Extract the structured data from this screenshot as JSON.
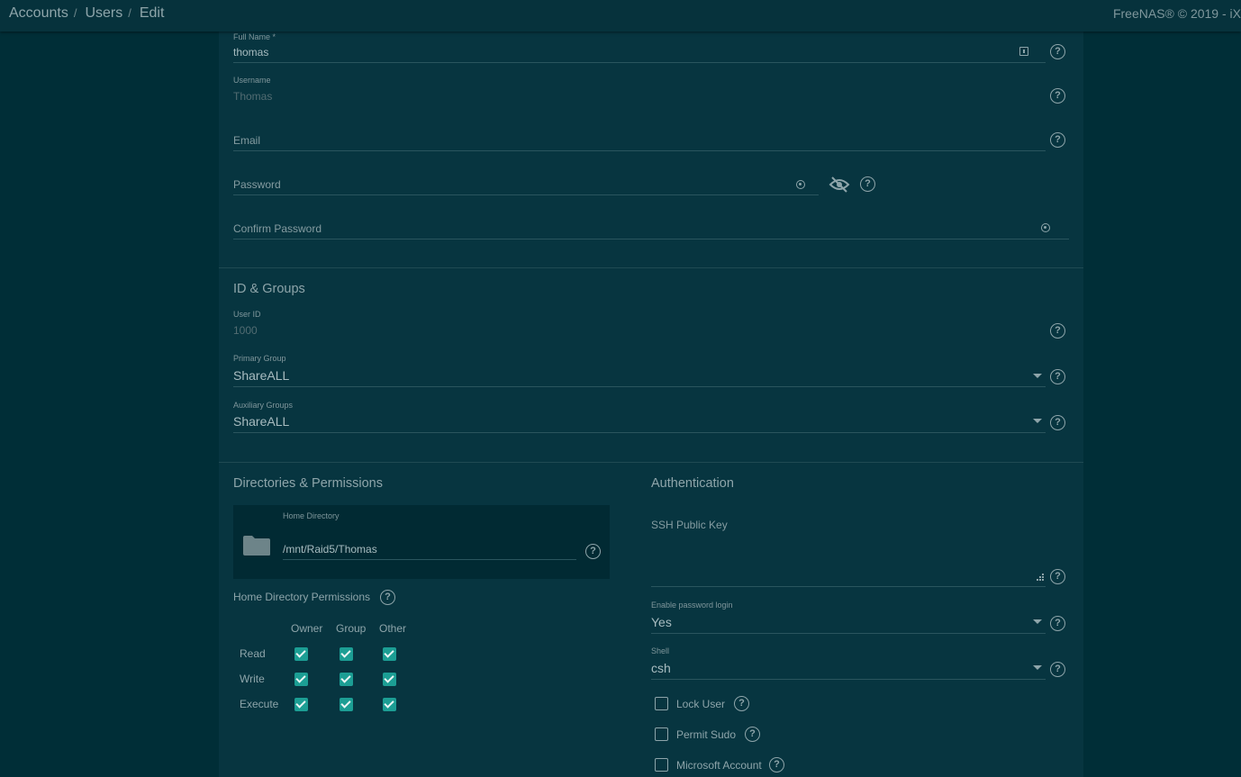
{
  "header": {
    "breadcrumbs": [
      "Accounts",
      "Users",
      "Edit"
    ],
    "copyright": "FreeNAS® © 2019 - iX"
  },
  "form": {
    "full_name": {
      "label": "Full Name *",
      "value": "thomas"
    },
    "username": {
      "label": "Username",
      "value": "Thomas"
    },
    "email": {
      "placeholder": "Email"
    },
    "password": {
      "placeholder": "Password"
    },
    "confirm_password": {
      "placeholder": "Confirm Password"
    },
    "id_groups": {
      "title": "ID & Groups",
      "user_id": {
        "label": "User ID",
        "value": "1000"
      },
      "primary_group": {
        "label": "Primary Group",
        "value": "ShareALL"
      },
      "auxiliary_groups": {
        "label": "Auxiliary Groups",
        "value": "ShareALL"
      }
    },
    "directories": {
      "title": "Directories & Permissions",
      "home_directory": {
        "label": "Home Directory",
        "value": "/mnt/Raid5/Thomas"
      },
      "permissions_label": "Home Directory Permissions",
      "columns": [
        "Owner",
        "Group",
        "Other"
      ],
      "rows": [
        {
          "label": "Read",
          "checked": [
            true,
            true,
            true
          ]
        },
        {
          "label": "Write",
          "checked": [
            true,
            true,
            true
          ]
        },
        {
          "label": "Execute",
          "checked": [
            true,
            true,
            true
          ]
        }
      ]
    },
    "authentication": {
      "title": "Authentication",
      "ssh_key": {
        "placeholder": "SSH Public Key"
      },
      "password_login": {
        "label": "Enable password login",
        "value": "Yes"
      },
      "shell": {
        "label": "Shell",
        "value": "csh"
      },
      "lock_user": {
        "label": "Lock User",
        "checked": false
      },
      "permit_sudo": {
        "label": "Permit Sudo",
        "checked": false
      },
      "microsoft_account": {
        "label": "Microsoft Account",
        "checked": false
      }
    }
  },
  "colors": {
    "background": "#002e37",
    "panel": "#073540",
    "accent_checkbox": "#1c9e94"
  }
}
